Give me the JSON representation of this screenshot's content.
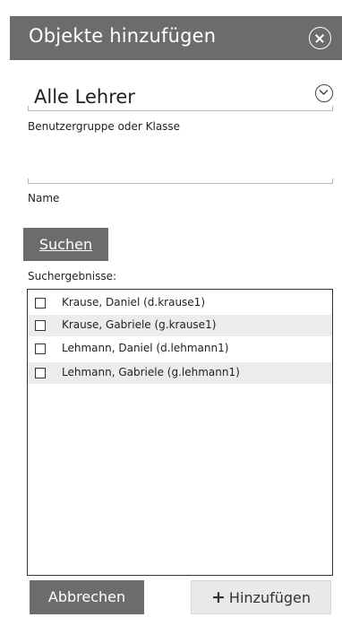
{
  "dialog": {
    "title": "Objekte hinzufügen",
    "close_icon": "close-circle-icon"
  },
  "group_select": {
    "value": "Alle Lehrer",
    "label": "Benutzergruppe oder Klasse",
    "icon": "chevron-down-circle-icon"
  },
  "name_field": {
    "value": "",
    "label": "Name"
  },
  "search_button": {
    "label": "Suchen"
  },
  "results": {
    "label": "Suchergebnisse:",
    "items": [
      {
        "text": "Krause, Daniel (d.krause1)",
        "checked": false
      },
      {
        "text": "Krause, Gabriele (g.krause1)",
        "checked": false
      },
      {
        "text": "Lehmann, Daniel (d.lehmann1)",
        "checked": false
      },
      {
        "text": "Lehmann, Gabriele (g.lehmann1)",
        "checked": false
      }
    ]
  },
  "footer": {
    "cancel_label": "Abbrechen",
    "add_label": "Hinzufügen",
    "add_icon": "plus-icon"
  },
  "colors": {
    "header_bg": "#6c6c6c",
    "primary_button": "#6c6c6c",
    "secondary_button": "#e9e9e9",
    "row_alt": "#ececec"
  }
}
